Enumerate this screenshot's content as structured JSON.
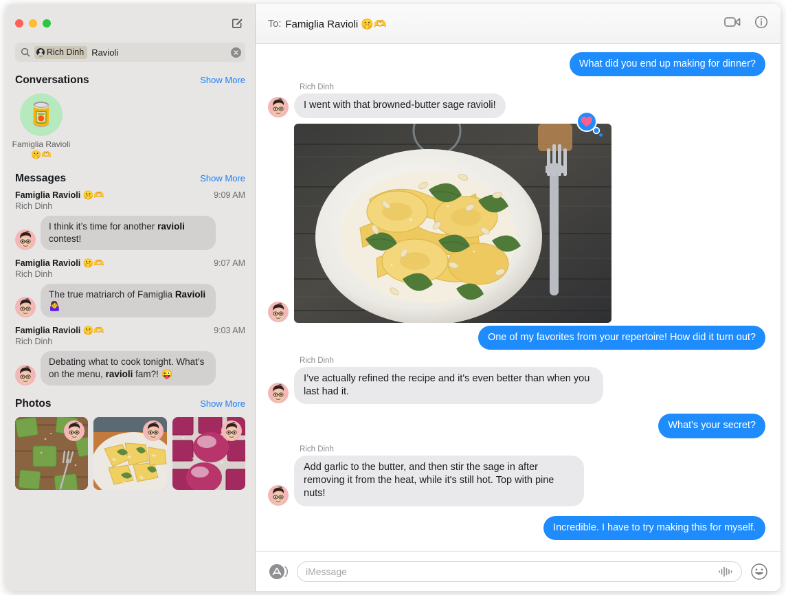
{
  "window": {
    "traffic_lights": [
      "close",
      "minimize",
      "zoom"
    ],
    "compose_icon": "compose-icon"
  },
  "search": {
    "icon": "search-icon",
    "token_label": "Rich Dinh",
    "query_text": "Ravioli",
    "clear_icon": "clear-icon"
  },
  "sidebar": {
    "conversations": {
      "title": "Conversations",
      "show_more": "Show More",
      "items": [
        {
          "avatar_emoji": "🥫",
          "label": "Famiglia Ravioli 🤫🫶"
        }
      ]
    },
    "messages": {
      "title": "Messages",
      "show_more": "Show More",
      "items": [
        {
          "group": "Famiglia Ravioli 🤫🫶",
          "sender": "Rich Dinh",
          "time": "9:09 AM",
          "text_before": "I think it’s time for another ",
          "highlight": "ravioli",
          "text_after": " contest!"
        },
        {
          "group": "Famiglia Ravioli 🤫🫶",
          "sender": "Rich Dinh",
          "time": "9:07 AM",
          "text_before": "The true matriarch of Famiglia ",
          "highlight": "Ravioli",
          "text_after": " 🤷‍♀️"
        },
        {
          "group": "Famiglia Ravioli 🤫🫶",
          "sender": "Rich Dinh",
          "time": "9:03 AM",
          "text_before": "Debating what to cook tonight. What’s on the menu, ",
          "highlight": "ravioli",
          "text_after": " fam?! 😜"
        }
      ]
    },
    "photos": {
      "title": "Photos",
      "show_more": "Show More",
      "items": [
        {
          "description": "green spinach ravioli on wooden board with fork"
        },
        {
          "description": "browned-butter sage ravioli on white plate"
        },
        {
          "description": "beet ravioli dusted with flour"
        }
      ]
    }
  },
  "header": {
    "to_label": "To:",
    "recipient": "Famiglia Ravioli 🤫🫶",
    "facetime_icon": "video-camera-icon",
    "info_icon": "info-icon"
  },
  "thread": {
    "messages": [
      {
        "side": "out",
        "text": "What did you end up making for dinner?"
      },
      {
        "side": "in",
        "sender": "Rich Dinh",
        "text": "I went with that browned-butter sage ravioli!"
      },
      {
        "side": "in",
        "type": "image",
        "description": "browned-butter sage ravioli with pine nuts on a white plate, rustic dark wood table with fork",
        "tapback": "heart"
      },
      {
        "side": "out",
        "text": "One of my favorites from your repertoire! How did it turn out?"
      },
      {
        "side": "in",
        "sender": "Rich Dinh",
        "text": "I’ve actually refined the recipe and it's even better than when you last had it."
      },
      {
        "side": "out",
        "text": "What's your secret?"
      },
      {
        "side": "in",
        "sender": "Rich Dinh",
        "text": "Add garlic to the butter, and then stir the sage in after removing it from the heat, while it's still hot. Top with pine nuts!"
      },
      {
        "side": "out",
        "text": "Incredible. I have to try making this for myself."
      }
    ]
  },
  "composer": {
    "appstore_icon": "app-store-icon",
    "placeholder": "iMessage",
    "value": "",
    "audio_icon": "audio-waveform-icon",
    "emoji_icon": "emoji-smiley-icon"
  },
  "colors": {
    "accent_blue": "#1f8cfd",
    "link_blue": "#1b7ff5",
    "sidebar_bg": "#e7e6e4",
    "gray_bubble": "#e9e9eb"
  }
}
